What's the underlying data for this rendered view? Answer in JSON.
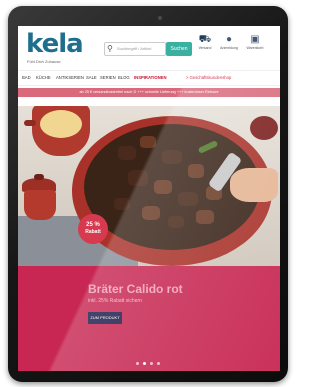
{
  "brand": {
    "logo": "kela",
    "tagline": "Fühl Dich Zuhause"
  },
  "search": {
    "placeholder": "Suchbegriff / Artikel",
    "button": "Suchen"
  },
  "header_icons": [
    {
      "icon": "truck-icon",
      "label": "Versand"
    },
    {
      "icon": "user-icon",
      "label": "Anmeldung"
    },
    {
      "icon": "cart-icon",
      "label": "Warenkorb"
    }
  ],
  "nav": {
    "items": [
      "BAD",
      "KÜCHE",
      "ANTIKSERIEN",
      "SALE",
      "SERIEN",
      "BLOG",
      "INSPIRATIONEN",
      "> Geschäftskundenshop"
    ],
    "active_index": 6
  },
  "promo_banner": "ab 25 € versandkostenfrei nach D +++ schnelle Lieferung +++ kostenloser Retoure",
  "hero": {
    "badge_percent": "25 %",
    "badge_text": "Rabatt",
    "product_title": "Bräter Calido rot",
    "product_subtitle": "inkl. 25% Rabatt sichern",
    "cta": "ZUM PRODUKT",
    "carousel_dots": 4,
    "active_dot": 1
  },
  "colors": {
    "brand": "#1f6e8e",
    "accent": "#c72752",
    "search_button": "#3ab0a0",
    "cta": "#1d1d4d"
  }
}
